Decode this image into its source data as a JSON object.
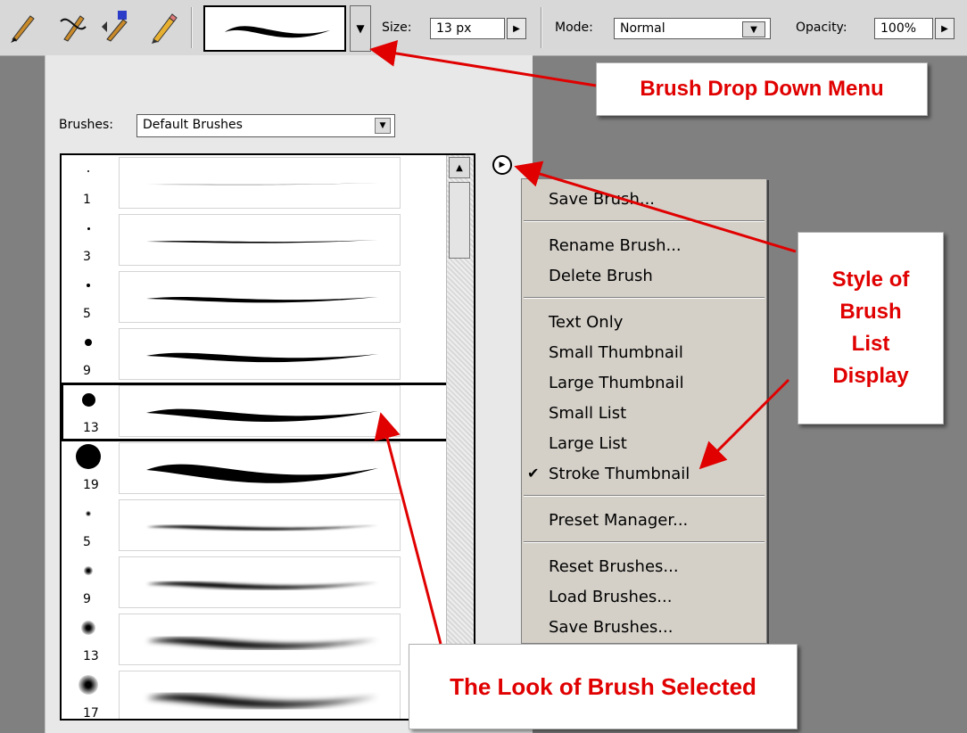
{
  "options_bar": {
    "size_label": "Size:",
    "size_value": "13 px",
    "mode_label": "Mode:",
    "mode_value": "Normal",
    "opacity_label": "Opacity:",
    "opacity_value": "100%"
  },
  "panel": {
    "brushes_label": "Brushes:",
    "brushes_value": "Default Brushes",
    "brush_sizes": [
      "1",
      "3",
      "5",
      "9",
      "13",
      "19",
      "5",
      "9",
      "13",
      "17"
    ],
    "selected_index": 4
  },
  "menu": {
    "items": [
      "Save Brush...",
      "Rename Brush...",
      "Delete Brush",
      "Text Only",
      "Small Thumbnail",
      "Large Thumbnail",
      "Small List",
      "Large List",
      "Stroke Thumbnail",
      "Preset Manager...",
      "Reset Brushes...",
      "Load Brushes...",
      "Save Brushes..."
    ],
    "checked_item": "Stroke Thumbnail"
  },
  "callouts": {
    "dropdown": "Brush Drop Down Menu",
    "style_lines": [
      "Style of",
      "Brush",
      "List",
      "Display"
    ],
    "selected": "The Look of Brush Selected"
  },
  "colors": {
    "callout_text": "#e00000",
    "arrow": "#e00000"
  }
}
